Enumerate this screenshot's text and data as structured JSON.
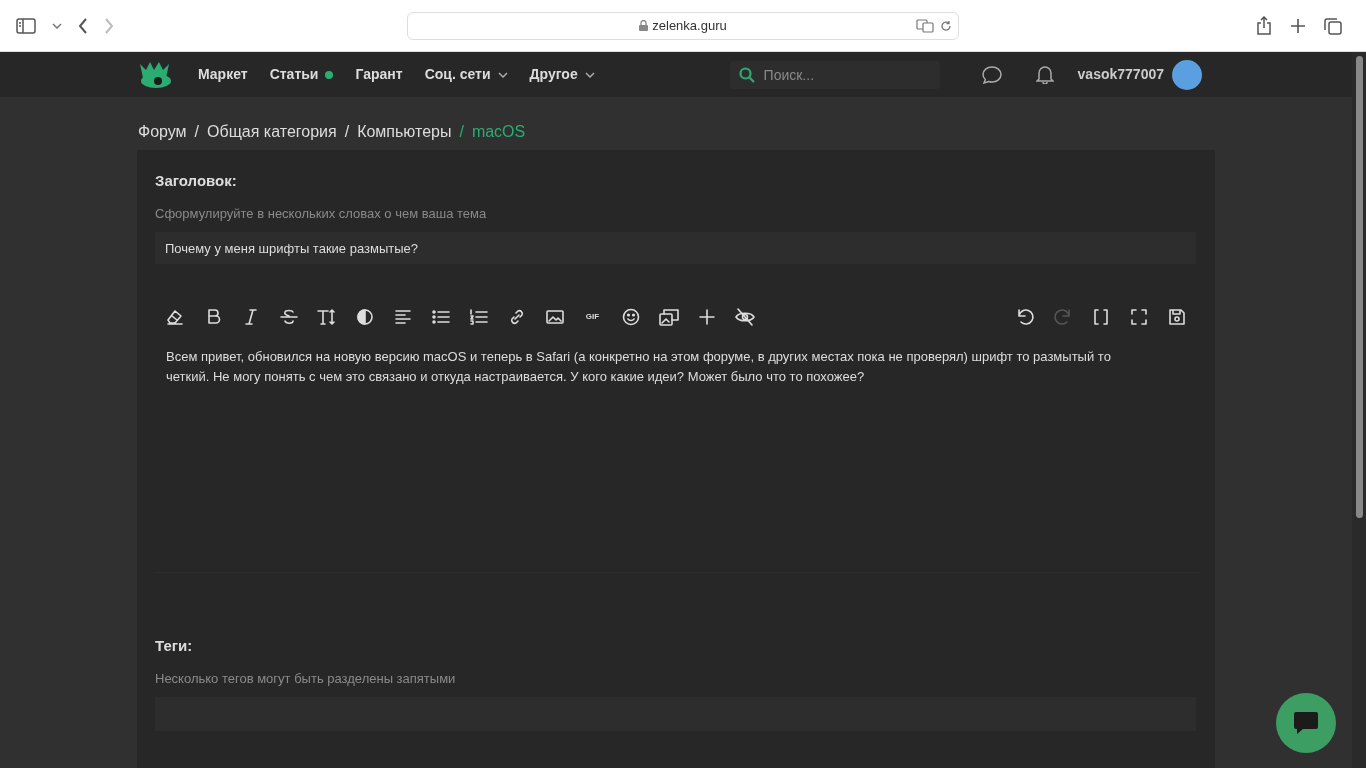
{
  "browser": {
    "address": "zelenka.guru"
  },
  "nav": {
    "items": [
      {
        "label": "Маркет",
        "dot": false,
        "dropdown": false
      },
      {
        "label": "Статьи",
        "dot": true,
        "dropdown": false
      },
      {
        "label": "Гарант",
        "dot": false,
        "dropdown": false
      },
      {
        "label": "Соц. сети",
        "dot": false,
        "dropdown": true
      },
      {
        "label": "Другое",
        "dot": false,
        "dropdown": true
      }
    ],
    "search": {
      "placeholder": "Поиск..."
    },
    "username": "vasok777007"
  },
  "breadcrumbs": [
    {
      "label": "Форум",
      "current": false
    },
    {
      "label": "Общая категория",
      "current": false
    },
    {
      "label": "Компьютеры",
      "current": false
    },
    {
      "label": "macOS",
      "current": true
    }
  ],
  "breadcrumb_separator": "/",
  "title_field": {
    "label": "Заголовок:",
    "hint": "Сформулируйте в нескольких словах о чем ваша тема",
    "value": "Почему у меня шрифты такие размытые?"
  },
  "toolbar_left": [
    {
      "kind": "eraser",
      "disabled": false
    },
    {
      "kind": "bold",
      "disabled": false
    },
    {
      "kind": "italic",
      "disabled": false
    },
    {
      "kind": "strike",
      "disabled": false
    },
    {
      "kind": "size",
      "disabled": false
    },
    {
      "kind": "contrast",
      "disabled": false
    },
    {
      "kind": "align",
      "disabled": false
    },
    {
      "kind": "bullets",
      "disabled": false
    },
    {
      "kind": "numbers",
      "disabled": false
    },
    {
      "kind": "link",
      "disabled": false
    },
    {
      "kind": "image",
      "disabled": false
    },
    {
      "kind": "gif",
      "label": "GIF",
      "disabled": false
    },
    {
      "kind": "smile",
      "disabled": false
    },
    {
      "kind": "gallery",
      "disabled": false
    },
    {
      "kind": "plus",
      "disabled": false
    },
    {
      "kind": "hide",
      "disabled": false
    }
  ],
  "toolbar_right": [
    {
      "kind": "undo",
      "disabled": false
    },
    {
      "kind": "redo",
      "disabled": true
    },
    {
      "kind": "brackets",
      "disabled": false
    },
    {
      "kind": "fullscreen",
      "disabled": false
    },
    {
      "kind": "save",
      "disabled": false
    }
  ],
  "editor_text": "Всем привет, обновился на новую версию macOS и теперь в Safari (а конкретно на этом форуме, в других местах пока не проверял) шрифт то размытый то четкий. Не могу понять с чем это связано и откуда настраивается. У кого какие идеи? Может было что то похожее?",
  "tags_field": {
    "label": "Теги:",
    "hint": "Несколько тегов могут быть разделены запятыми"
  }
}
